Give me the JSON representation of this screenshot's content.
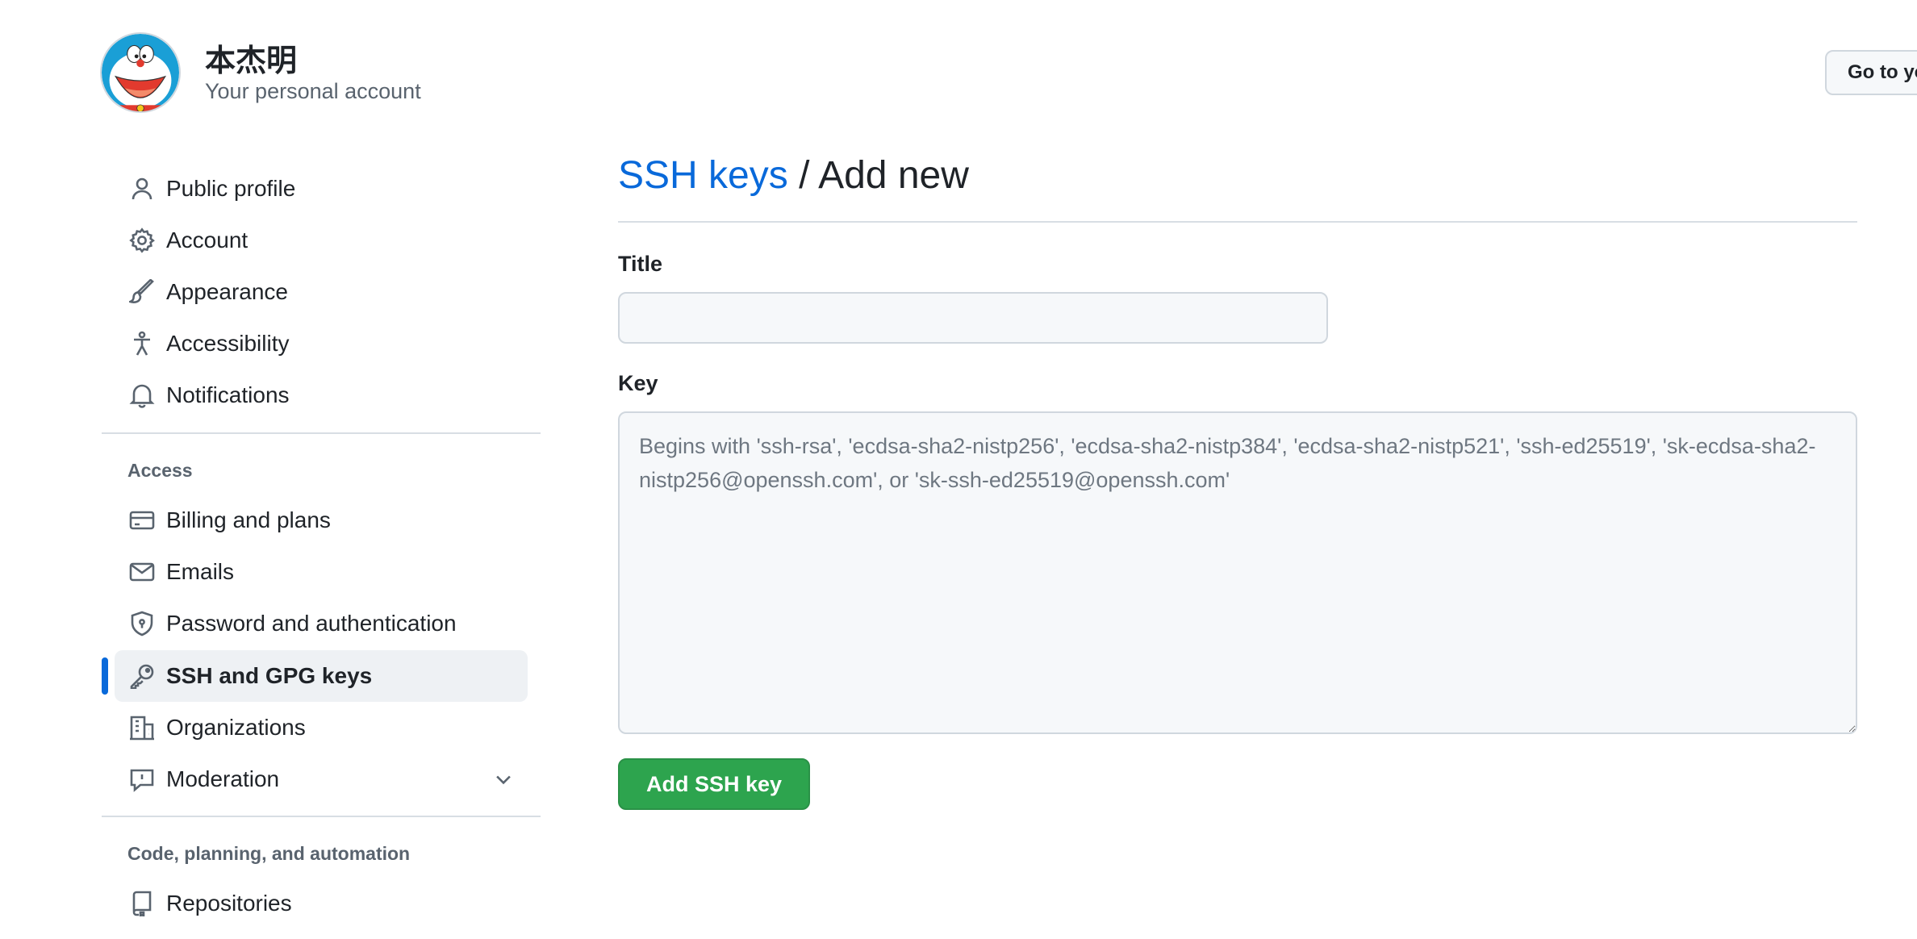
{
  "account": {
    "name": "本杰明",
    "subtitle": "Your personal account",
    "goto_button": "Go to yo"
  },
  "sidebar": {
    "top_items": [
      {
        "label": "Public profile",
        "icon": "person-icon"
      },
      {
        "label": "Account",
        "icon": "gear-icon"
      },
      {
        "label": "Appearance",
        "icon": "paintbrush-icon"
      },
      {
        "label": "Accessibility",
        "icon": "accessibility-icon"
      },
      {
        "label": "Notifications",
        "icon": "bell-icon"
      }
    ],
    "access_title": "Access",
    "access_items": [
      {
        "label": "Billing and plans",
        "icon": "credit-card-icon"
      },
      {
        "label": "Emails",
        "icon": "mail-icon"
      },
      {
        "label": "Password and authentication",
        "icon": "shield-lock-icon"
      },
      {
        "label": "SSH and GPG keys",
        "icon": "key-icon",
        "active": true
      },
      {
        "label": "Organizations",
        "icon": "organization-icon"
      },
      {
        "label": "Moderation",
        "icon": "report-icon",
        "expandable": true
      }
    ],
    "code_title": "Code, planning, and automation",
    "code_items": [
      {
        "label": "Repositories",
        "icon": "repo-icon"
      }
    ]
  },
  "main": {
    "heading_link": "SSH keys",
    "heading_sep": " / Add new",
    "title_label": "Title",
    "title_value": "",
    "key_label": "Key",
    "key_placeholder": "Begins with 'ssh-rsa', 'ecdsa-sha2-nistp256', 'ecdsa-sha2-nistp384', 'ecdsa-sha2-nistp521', 'ssh-ed25519', 'sk-ecdsa-sha2-nistp256@openssh.com', or 'sk-ssh-ed25519@openssh.com'",
    "submit_label": "Add SSH key"
  },
  "colors": {
    "accent": "#0969da",
    "success": "#2da44e",
    "muted": "#59636e"
  }
}
